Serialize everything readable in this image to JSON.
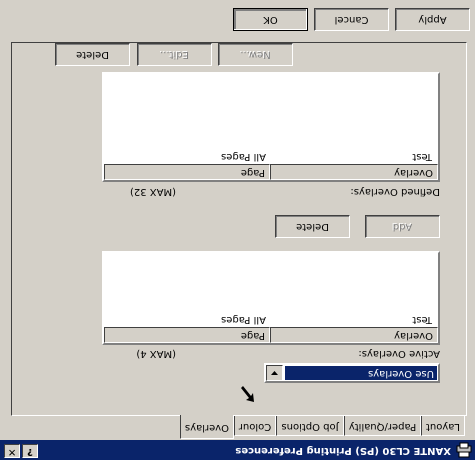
{
  "window": {
    "title": "XANTE CL30 (PS) Printing Preferences",
    "help_button": "?",
    "close_button": "✕"
  },
  "tabs": [
    {
      "label": "Layout"
    },
    {
      "label": "Paper/Quality"
    },
    {
      "label": "Job Options"
    },
    {
      "label": "Colour"
    },
    {
      "label": "Overlays"
    }
  ],
  "overlay_mode": {
    "selected": "Use Overlays"
  },
  "active_overlays": {
    "label": "Active Overlays:",
    "max": "(MAX 4)",
    "columns": [
      "Overlay",
      "Page"
    ],
    "rows": [
      {
        "overlay": "Test",
        "page": "All Pages"
      }
    ],
    "buttons": {
      "add": "Add",
      "delete": "Delete"
    }
  },
  "defined_overlays": {
    "label": "Defined Overlays:",
    "max": "(MAX 32)",
    "columns": [
      "Overlay",
      "Page"
    ],
    "rows": [
      {
        "overlay": "Test",
        "page": "All Pages"
      }
    ],
    "buttons": {
      "new": "New...",
      "edit": "Edit...",
      "delete": "Delete"
    }
  },
  "dialog_buttons": {
    "ok": "OK",
    "cancel": "Cancel",
    "apply": "Apply"
  },
  "colors": {
    "titlebar": "#0a246a",
    "face": "#d4d0c8",
    "selection": "#0a246a"
  }
}
